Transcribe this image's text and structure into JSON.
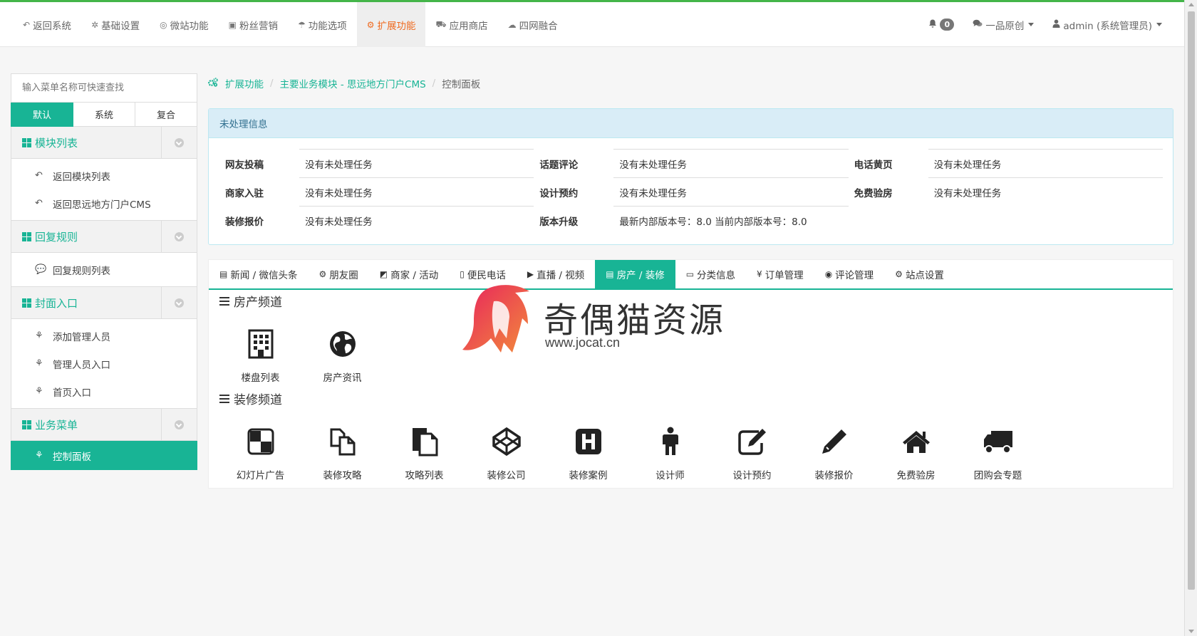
{
  "topnav": {
    "items": [
      {
        "label": "返回系统",
        "icon": "reply-icon",
        "glyph": "↶"
      },
      {
        "label": "基础设置",
        "icon": "cog-icon",
        "glyph": "✲"
      },
      {
        "label": "微站功能",
        "icon": "lifebuoy-icon",
        "glyph": "◎"
      },
      {
        "label": "粉丝营销",
        "icon": "gift-icon",
        "glyph": "▣"
      },
      {
        "label": "功能选项",
        "icon": "umbrella-icon",
        "glyph": "☂"
      },
      {
        "label": "扩展功能",
        "icon": "cogs-icon",
        "glyph": "⚙"
      },
      {
        "label": "应用商店",
        "icon": "cart-icon",
        "glyph": "⛟"
      },
      {
        "label": "四网融合",
        "icon": "cloud-upload-icon",
        "glyph": "☁"
      }
    ],
    "active_index": 5
  },
  "topright": {
    "bell_count": "0",
    "bell_glyph": "🔔",
    "chat_label": "一品原创",
    "chat_glyph": "💬",
    "user_label": "admin (系统管理员)",
    "user_glyph": "👤"
  },
  "sidebar": {
    "search_placeholder": "输入菜单名称可快速查找",
    "tabs": [
      "默认",
      "系统",
      "复合"
    ],
    "groups": [
      {
        "title": "模块列表",
        "items": [
          {
            "label": "返回模块列表",
            "glyph": "↶"
          },
          {
            "label": "返回思远地方门户CMS",
            "glyph": "↶"
          }
        ]
      },
      {
        "title": "回复规则",
        "items": [
          {
            "label": "回复规则列表",
            "glyph": "💬"
          }
        ]
      },
      {
        "title": "封面入口",
        "items": [
          {
            "label": "添加管理人员",
            "glyph": "⚘"
          },
          {
            "label": "管理人员入口",
            "glyph": "⚘"
          },
          {
            "label": "首页入口",
            "glyph": "⚘"
          }
        ]
      },
      {
        "title": "业务菜单",
        "items": [
          {
            "label": "控制面板",
            "glyph": "⚘"
          }
        ]
      }
    ]
  },
  "breadcrumb": {
    "glyph": "⚙",
    "items": [
      "扩展功能",
      "主要业务模块 - 思远地方门户CMS",
      "控制面板"
    ]
  },
  "info_panel": {
    "title": "未处理信息",
    "rows": [
      [
        {
          "label": "网友投稿",
          "value": "没有未处理任务"
        },
        {
          "label": "话题评论",
          "value": "没有未处理任务"
        },
        {
          "label": "电话黄页",
          "value": "没有未处理任务"
        }
      ],
      [
        {
          "label": "商家入驻",
          "value": "没有未处理任务"
        },
        {
          "label": "设计预约",
          "value": "没有未处理任务"
        },
        {
          "label": "免费验房",
          "value": "没有未处理任务"
        }
      ],
      [
        {
          "label": "装修报价",
          "value": "没有未处理任务"
        },
        {
          "label": "版本升级",
          "value": "最新内部版本号：8.0   当前内部版本号：8.0"
        },
        {
          "label": "",
          "value": ""
        }
      ]
    ]
  },
  "tabs": {
    "items": [
      {
        "label": "新闻 / 微信头条",
        "glyph": "▤"
      },
      {
        "label": "朋友圈",
        "glyph": "⚙"
      },
      {
        "label": "商家 / 活动",
        "glyph": "◩"
      },
      {
        "label": "便民电话",
        "glyph": "▯"
      },
      {
        "label": "直播 / 视频",
        "glyph": "▶"
      },
      {
        "label": "房产 / 装修",
        "glyph": "▤"
      },
      {
        "label": "分类信息",
        "glyph": "▭"
      },
      {
        "label": "订单管理",
        "glyph": "¥"
      },
      {
        "label": "评论管理",
        "glyph": "◉"
      },
      {
        "label": "站点设置",
        "glyph": "⚙"
      }
    ],
    "active_index": 5
  },
  "sections": [
    {
      "title": "房产频道",
      "tiles": [
        {
          "label": "楼盘列表",
          "icon": "building-icon"
        },
        {
          "label": "房产资讯",
          "icon": "globe-icon"
        }
      ]
    },
    {
      "title": "装修频道",
      "tiles": [
        {
          "label": "幻灯片广告",
          "icon": "checker-icon"
        },
        {
          "label": "装修攻略",
          "icon": "copy-icon"
        },
        {
          "label": "攻略列表",
          "icon": "files-icon"
        },
        {
          "label": "装修公司",
          "icon": "codepen-icon"
        },
        {
          "label": "装修案例",
          "icon": "h-square-icon"
        },
        {
          "label": "设计师",
          "icon": "male-icon"
        },
        {
          "label": "设计预约",
          "icon": "edit-icon"
        },
        {
          "label": "装修报价",
          "icon": "pencil-icon"
        },
        {
          "label": "免费验房",
          "icon": "home-icon"
        },
        {
          "label": "团购会专题",
          "icon": "truck-icon"
        }
      ]
    }
  ],
  "watermark": {
    "text": "奇偶猫资源",
    "url": "www.jocat.cn"
  },
  "colors": {
    "accent": "#18b495",
    "active_top": "#ef6a1f",
    "top_border": "#44b549",
    "info_bg": "#d9edf7"
  }
}
